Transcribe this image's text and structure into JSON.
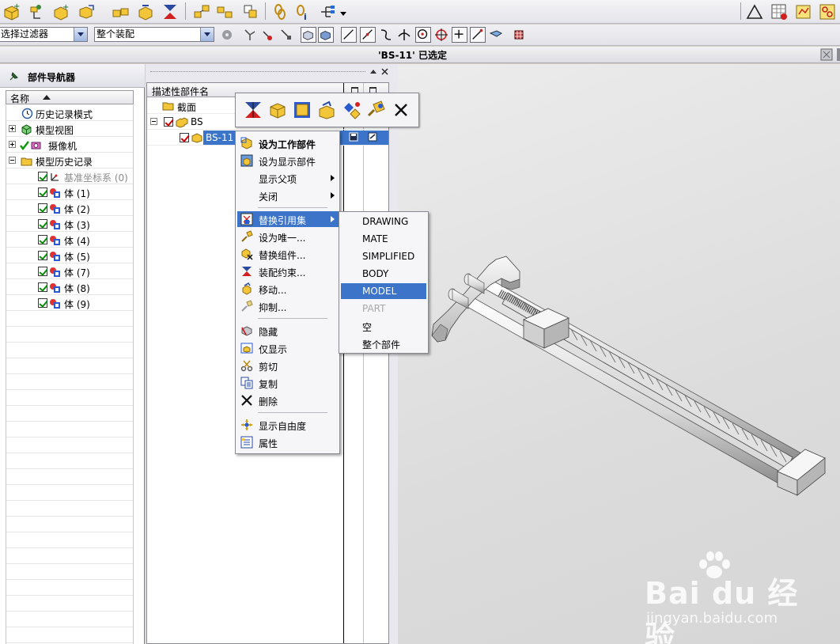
{
  "status": {
    "message": "'BS-11' 已选定"
  },
  "selection_bar": {
    "filter_value": "选择过滤器",
    "scope_value": "整个装配"
  },
  "part_navigator": {
    "title": "部件导航器",
    "column_name": "名称",
    "tree": [
      {
        "label": "历史记录模式",
        "icon": "clock-icon"
      },
      {
        "label": "模型视图",
        "icon": "model-views-icon"
      },
      {
        "label": "摄像机",
        "icon": "camera-icon"
      },
      {
        "label": "模型历史记录",
        "icon": "folder-icon"
      },
      {
        "label": "基准坐标系 (0)",
        "icon": "datum-csys-icon",
        "dimmed": true
      },
      {
        "label": "体 (1)",
        "icon": "body-icon"
      },
      {
        "label": "体 (2)",
        "icon": "body-icon"
      },
      {
        "label": "体 (3)",
        "icon": "body-icon"
      },
      {
        "label": "体 (4)",
        "icon": "body-icon"
      },
      {
        "label": "体 (5)",
        "icon": "body-icon"
      },
      {
        "label": "体 (7)",
        "icon": "body-icon"
      },
      {
        "label": "体 (8)",
        "icon": "body-icon"
      },
      {
        "label": "体 (9)",
        "icon": "body-icon"
      }
    ]
  },
  "assembly_navigator": {
    "column_name": "描述性部件名",
    "rows": [
      {
        "label": "截面",
        "icon": "folder-icon"
      },
      {
        "label": "BS",
        "icon": "assembly-icon"
      },
      {
        "label": "BS-11",
        "icon": "component-icon",
        "selected": true
      }
    ]
  },
  "context_menu": {
    "items": [
      {
        "label": "设为工作部件",
        "icon": "work-part-icon",
        "bold": true
      },
      {
        "label": "设为显示部件",
        "icon": "display-part-icon"
      },
      {
        "label": "显示父项",
        "icon": "",
        "submenu": true
      },
      {
        "label": "关闭",
        "icon": "",
        "submenu": true
      },
      {
        "label": "替换引用集",
        "icon": "replace-refset-icon",
        "submenu": true,
        "highlighted": true
      },
      {
        "label": "设为唯一...",
        "icon": "make-unique-icon"
      },
      {
        "label": "替换组件...",
        "icon": "replace-component-icon"
      },
      {
        "label": "装配约束...",
        "icon": "assembly-constraint-icon"
      },
      {
        "label": "移动...",
        "icon": "move-icon"
      },
      {
        "label": "抑制...",
        "icon": "suppress-icon"
      },
      {
        "label": "隐藏",
        "icon": "hide-icon"
      },
      {
        "label": "仅显示",
        "icon": "show-only-icon"
      },
      {
        "label": "剪切",
        "icon": "cut-icon"
      },
      {
        "label": "复制",
        "icon": "copy-icon"
      },
      {
        "label": "删除",
        "icon": "delete-icon"
      },
      {
        "label": "显示自由度",
        "icon": "dof-icon"
      },
      {
        "label": "属性",
        "icon": "properties-icon"
      }
    ]
  },
  "refset_submenu": {
    "items": [
      {
        "label": "DRAWING"
      },
      {
        "label": "MATE"
      },
      {
        "label": "SIMPLIFIED"
      },
      {
        "label": "BODY"
      },
      {
        "label": "MODEL",
        "highlighted": true
      },
      {
        "label": "PART",
        "disabled": true
      },
      {
        "label": "空"
      },
      {
        "label": "整个部件"
      }
    ]
  },
  "watermark": {
    "brand": "Bai du 经验",
    "url": "jingyan.baidu.com"
  },
  "colors": {
    "highlight": "#3b74c8",
    "check_green": "#0a8a0a",
    "check_red": "#d00000"
  }
}
